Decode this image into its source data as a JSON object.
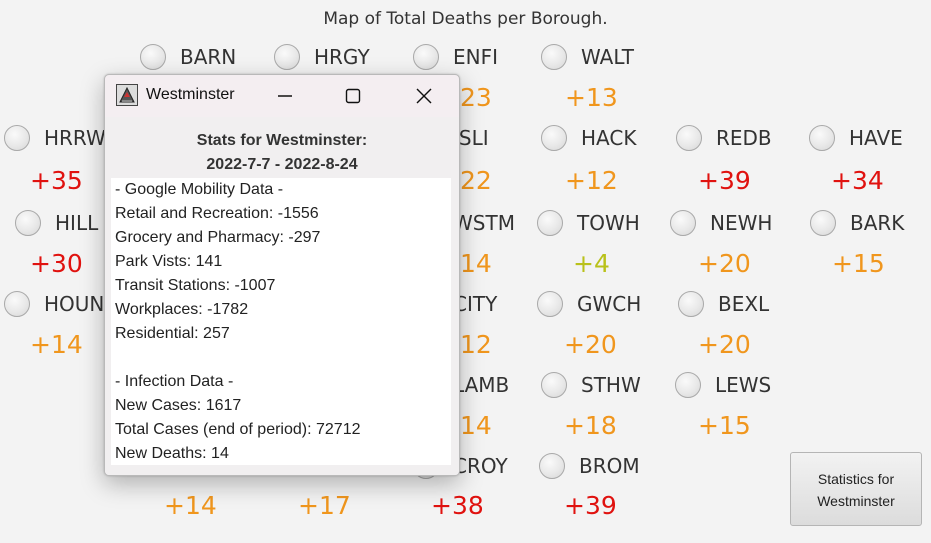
{
  "window": {
    "heading": "Map of Total Deaths per Borough."
  },
  "colors": {
    "red": "#e0120f",
    "orange": "#f0961d",
    "yellow_green": "#b9c11a"
  },
  "boroughs": [
    {
      "code": "BARN",
      "delta": "",
      "color": "orange"
    },
    {
      "code": "HRGY",
      "delta": "",
      "color": "orange"
    },
    {
      "code": "ENFI",
      "delta": "+23",
      "color": "orange"
    },
    {
      "code": "WALT",
      "delta": "+13",
      "color": "orange"
    },
    {
      "code": "HRRW",
      "delta": "+35",
      "color": "red"
    },
    {
      "code": "ISLI",
      "delta": "+22",
      "color": "orange"
    },
    {
      "code": "HACK",
      "delta": "+12",
      "color": "orange"
    },
    {
      "code": "REDB",
      "delta": "+39",
      "color": "red"
    },
    {
      "code": "HAVE",
      "delta": "+34",
      "color": "red"
    },
    {
      "code": "HILL",
      "delta": "+30",
      "color": "red"
    },
    {
      "code": "WSTM",
      "delta": "+14",
      "color": "orange"
    },
    {
      "code": "TOWH",
      "delta": "+4",
      "color": "yellow_green"
    },
    {
      "code": "NEWH",
      "delta": "+20",
      "color": "orange"
    },
    {
      "code": "BARK",
      "delta": "+15",
      "color": "orange"
    },
    {
      "code": "HOUN",
      "delta": "+14",
      "color": "orange"
    },
    {
      "code": "CITY",
      "delta": "+12",
      "color": "orange"
    },
    {
      "code": "GWCH",
      "delta": "+20",
      "color": "orange"
    },
    {
      "code": "BEXL",
      "delta": "+20",
      "color": "orange"
    },
    {
      "code": "LAMB",
      "delta": "+14",
      "color": "orange"
    },
    {
      "code": "STHW",
      "delta": "+18",
      "color": "orange"
    },
    {
      "code": "LEWS",
      "delta": "+15",
      "color": "orange"
    },
    {
      "code": "",
      "delta": "+14",
      "color": "orange"
    },
    {
      "code": "",
      "delta": "+17",
      "color": "orange"
    },
    {
      "code": "CROY",
      "delta": "+38",
      "color": "red"
    },
    {
      "code": "BROM",
      "delta": "+39",
      "color": "red"
    }
  ],
  "stats_button": {
    "line1": "Statistics for",
    "line2": "Westminster"
  },
  "dialog": {
    "title": "Westminster",
    "icon": "java-app-icon",
    "heading_line1": "Stats for Westminster:",
    "heading_line2": "2022-7-7 - 2022-8-24",
    "lines": [
      "- Google Mobility Data -",
      "Retail and Recreation: -1556",
      "Grocery and Pharmacy: -297",
      "Park Vists: 141",
      "Transit Stations: -1007",
      "Workplaces: -1782",
      "Residential: 257",
      "",
      "- Infection Data -",
      "New Cases: 1617",
      "Total Cases (end of period): 72712",
      "New Deaths: 14"
    ]
  }
}
